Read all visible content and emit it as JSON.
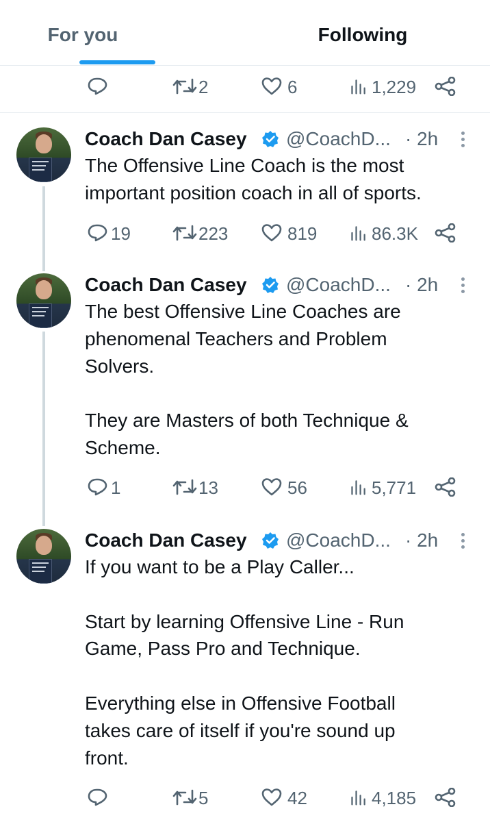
{
  "tabs": {
    "for_you": "For you",
    "following": "Following"
  },
  "top_actions": {
    "reply": "",
    "retweets": "2",
    "likes": "6",
    "views": "1,229"
  },
  "tweets": [
    {
      "name": "Coach Dan Casey",
      "handle": "@CoachD...",
      "time": "· 2h",
      "text": "The Offensive Line Coach is the most\nimportant position coach in all of sports.",
      "reply": "19",
      "retweets": "223",
      "likes": "819",
      "views": "86.3K"
    },
    {
      "name": "Coach Dan Casey",
      "handle": "@CoachD...",
      "time": "· 2h",
      "text": "The best Offensive Line Coaches are\nphenomenal Teachers and Problem\nSolvers.\n\nThey are Masters of both Technique &\nScheme.",
      "reply": "1",
      "retweets": "13",
      "likes": "56",
      "views": "5,771"
    },
    {
      "name": "Coach Dan Casey",
      "handle": "@CoachD...",
      "time": "· 2h",
      "text": "If you want to be a Play Caller...\n\nStart by learning Offensive Line - Run\nGame, Pass Pro and Technique.\n\nEverything else in Offensive Football\ntakes care of itself if you're sound up\nfront.",
      "reply": "",
      "retweets": "5",
      "likes": "42",
      "views": "4,185"
    }
  ],
  "colors": {
    "accent": "#1d9bf0",
    "verified": "#1d9bf0",
    "muted": "#536471",
    "text": "#0f1419"
  },
  "icons": [
    "reply-icon",
    "retweet-icon",
    "like-icon",
    "views-icon",
    "share-icon",
    "verified-badge-icon",
    "more-icon"
  ]
}
